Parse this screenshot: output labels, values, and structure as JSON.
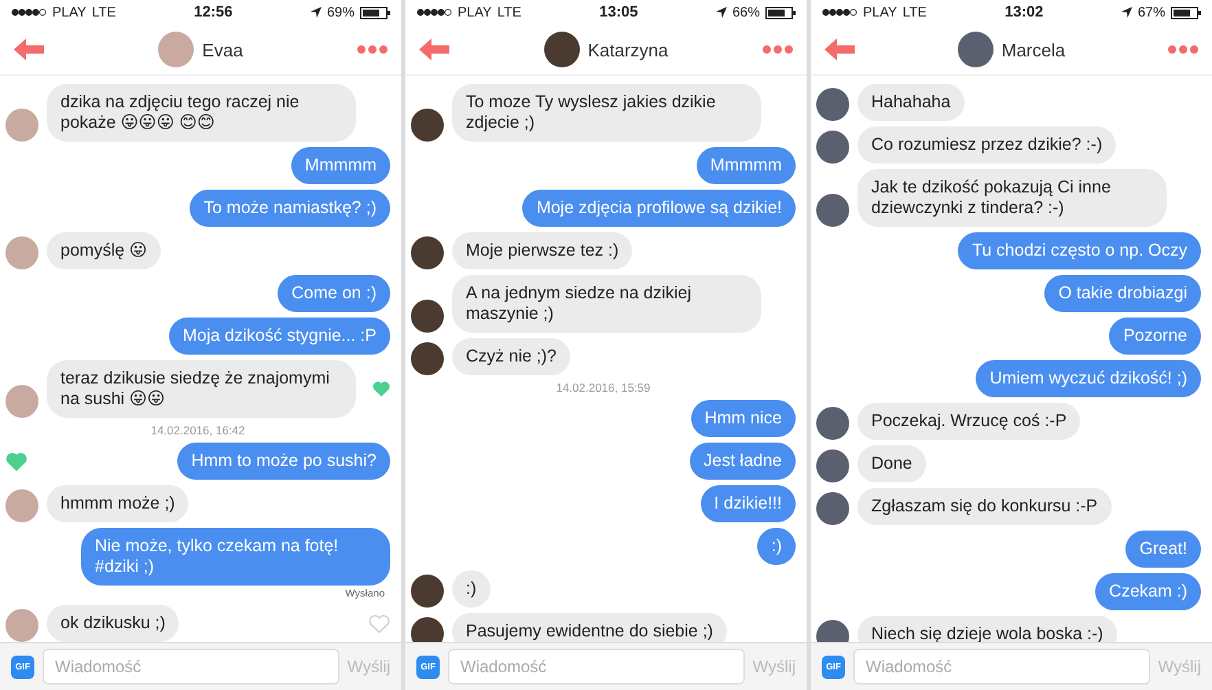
{
  "chats": [
    {
      "status_bar": {
        "carrier": "PLAY",
        "network": "LTE",
        "time": "12:56",
        "battery": "69%"
      },
      "contact": "Evaa",
      "messages": [
        {
          "kind": "in",
          "text": "dzika na zdjęciu tego raczej nie pokaże 😛😛😛 😊😊"
        },
        {
          "kind": "out",
          "text": "Mmmmm"
        },
        {
          "kind": "out",
          "text": "To może namiastkę? ;)"
        },
        {
          "kind": "in",
          "text": "pomyślę 😛"
        },
        {
          "kind": "out",
          "text": "Come on :)"
        },
        {
          "kind": "out",
          "text": "Moja dzikość stygnie... :P"
        },
        {
          "kind": "in",
          "text": "teraz dzikusie siedzę że znajomymi na sushi 😛😛",
          "liked": true
        },
        {
          "kind": "timestamp",
          "text": "14.02.2016, 16:42"
        },
        {
          "kind": "out",
          "text": "Hmm to może po sushi?",
          "liked": true
        },
        {
          "kind": "in",
          "text": "hmmm może ;)"
        },
        {
          "kind": "out",
          "text": "Nie może, tylko czekam na fotę! #dziki ;)"
        },
        {
          "kind": "status",
          "text": "Wysłano"
        },
        {
          "kind": "in",
          "text": "ok dzikusku ;)",
          "liked": false
        }
      ],
      "composer": {
        "placeholder": "Wiadomość",
        "send": "Wyślij",
        "gif": "GIF"
      }
    },
    {
      "status_bar": {
        "carrier": "PLAY",
        "network": "LTE",
        "time": "13:05",
        "battery": "66%"
      },
      "contact": "Katarzyna",
      "messages": [
        {
          "kind": "in",
          "text": "To moze Ty wyslesz jakies dzikie zdjecie ;)"
        },
        {
          "kind": "out",
          "text": "Mmmmm"
        },
        {
          "kind": "out",
          "text": "Moje zdjęcia profilowe są dzikie!"
        },
        {
          "kind": "in",
          "text": "Moje pierwsze tez :)"
        },
        {
          "kind": "in",
          "text": "A na jednym siedze na dzikiej maszynie ;)"
        },
        {
          "kind": "in",
          "text": "Czyż nie ;)?"
        },
        {
          "kind": "timestamp",
          "text": "14.02.2016, 15:59"
        },
        {
          "kind": "out",
          "text": "Hmm nice"
        },
        {
          "kind": "out",
          "text": "Jest ładne"
        },
        {
          "kind": "out",
          "text": "I dzikie!!!"
        },
        {
          "kind": "out",
          "text": ":)"
        },
        {
          "kind": "in",
          "text": ":)"
        },
        {
          "kind": "in",
          "text": "Pasujemy ewidentne do siebie ;)"
        }
      ],
      "composer": {
        "placeholder": "Wiadomość",
        "send": "Wyślij",
        "gif": "GIF"
      }
    },
    {
      "status_bar": {
        "carrier": "PLAY",
        "network": "LTE",
        "time": "13:02",
        "battery": "67%"
      },
      "contact": "Marcela",
      "messages": [
        {
          "kind": "in",
          "text": "Hahahaha"
        },
        {
          "kind": "in",
          "text": "Co rozumiesz przez dzikie? :-)"
        },
        {
          "kind": "in",
          "text": "Jak te dzikość pokazują Ci inne dziewczynki z tindera? :-)"
        },
        {
          "kind": "out",
          "text": "Tu chodzi często o np. Oczy"
        },
        {
          "kind": "out",
          "text": "O takie drobiazgi"
        },
        {
          "kind": "out",
          "text": "Pozorne"
        },
        {
          "kind": "out",
          "text": "Umiem wyczuć dzikość! ;)"
        },
        {
          "kind": "in",
          "text": "Poczekaj. Wrzucę coś :-P"
        },
        {
          "kind": "in",
          "text": "Done"
        },
        {
          "kind": "in",
          "text": "Zgłaszam się do konkursu :-P"
        },
        {
          "kind": "out",
          "text": "Great!"
        },
        {
          "kind": "out",
          "text": "Czekam :)"
        },
        {
          "kind": "in",
          "text": "Niech się dzieje wola boska :-)"
        }
      ],
      "composer": {
        "placeholder": "Wiadomość",
        "send": "Wyślij",
        "gif": "GIF"
      }
    }
  ]
}
